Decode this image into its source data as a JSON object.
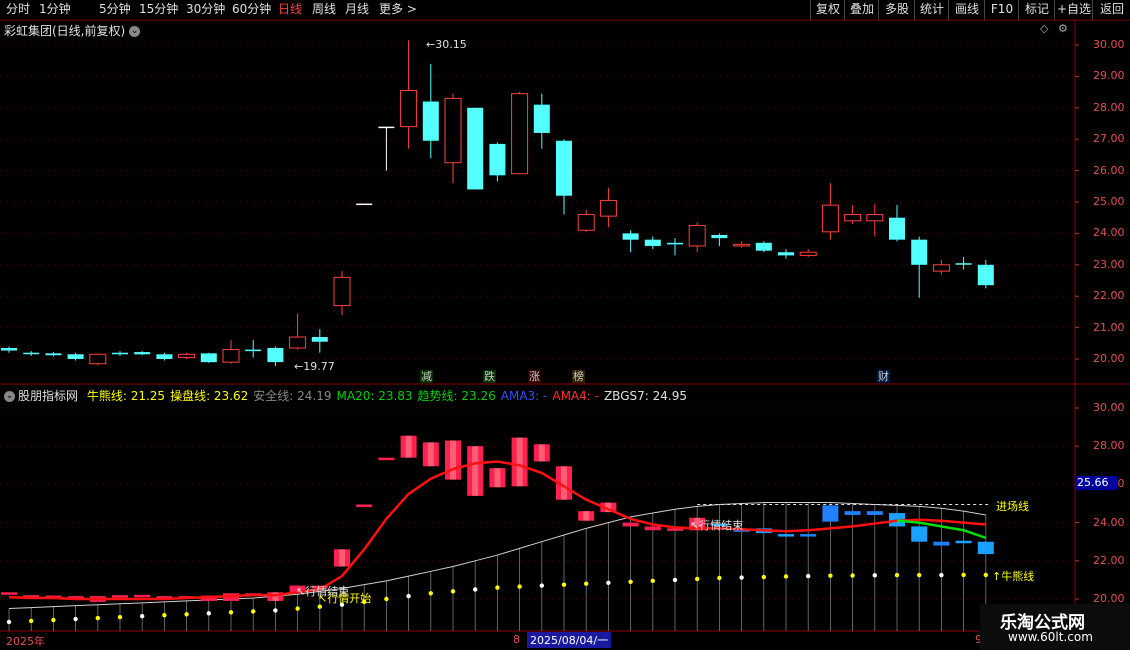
{
  "toolbar": {
    "periods": [
      "分时",
      "1分钟",
      "5分钟",
      "15分钟",
      "30分钟",
      "60分钟",
      "日线",
      "周线",
      "月线",
      "更多"
    ],
    "active_period": "日线",
    "more_arrow": ">",
    "right_buttons": [
      "复权",
      "叠加",
      "多股",
      "统计",
      "画线",
      "F10",
      "标记",
      "+自选",
      "返回"
    ]
  },
  "main_chart": {
    "title": "彩虹集团(日线,前复权)",
    "title_color": "#e0e0e0",
    "high_label": "30.15",
    "low_label": "19.77",
    "axis_labels": [
      "30.00",
      "29.00",
      "28.00",
      "27.00",
      "26.00",
      "25.00",
      "24.00",
      "23.00",
      "22.00",
      "21.00",
      "20.00"
    ],
    "event_marks": [
      {
        "text": "减",
        "color": "#00a000"
      },
      {
        "text": "跌",
        "color": "#00a000"
      },
      {
        "text": "涨",
        "color": "#c00000"
      },
      {
        "text": "榜",
        "color": "#8a5000"
      },
      {
        "text": "财",
        "color": "#2050c0"
      }
    ],
    "candles": [
      {
        "o": 20.27,
        "c": 20.35,
        "h": 20.4,
        "l": 20.2,
        "type": "down"
      },
      {
        "o": 20.2,
        "c": 20.16,
        "h": 20.25,
        "l": 20.1,
        "type": "down"
      },
      {
        "o": 20.18,
        "c": 20.12,
        "h": 20.22,
        "l": 20.08,
        "type": "down"
      },
      {
        "o": 20.15,
        "c": 20.0,
        "h": 20.2,
        "l": 19.95,
        "type": "down"
      },
      {
        "o": 19.85,
        "c": 20.15,
        "h": 20.18,
        "l": 19.8,
        "type": "up"
      },
      {
        "o": 20.2,
        "c": 20.15,
        "h": 20.25,
        "l": 20.1,
        "type": "down"
      },
      {
        "o": 20.22,
        "c": 20.15,
        "h": 20.25,
        "l": 20.12,
        "type": "down"
      },
      {
        "o": 20.15,
        "c": 20.0,
        "h": 20.2,
        "l": 19.95,
        "type": "down"
      },
      {
        "o": 20.05,
        "c": 20.15,
        "h": 20.2,
        "l": 20.0,
        "type": "up"
      },
      {
        "o": 20.18,
        "c": 19.9,
        "h": 20.2,
        "l": 19.88,
        "type": "down"
      },
      {
        "o": 19.9,
        "c": 20.3,
        "h": 20.6,
        "l": 19.85,
        "type": "up"
      },
      {
        "o": 20.3,
        "c": 20.25,
        "h": 20.6,
        "l": 20.05,
        "type": "down"
      },
      {
        "o": 20.35,
        "c": 19.9,
        "h": 20.4,
        "l": 19.77,
        "type": "down"
      },
      {
        "o": 20.35,
        "c": 20.7,
        "h": 21.45,
        "l": 20.3,
        "type": "up"
      },
      {
        "o": 20.7,
        "c": 20.55,
        "h": 20.95,
        "l": 20.2,
        "type": "down"
      },
      {
        "o": 21.7,
        "c": 22.6,
        "h": 22.8,
        "l": 21.4,
        "type": "up"
      },
      {
        "o": 24.95,
        "c": 24.95,
        "h": 24.95,
        "l": 24.95,
        "type": "flat"
      },
      {
        "o": 27.4,
        "c": 27.4,
        "h": 27.4,
        "l": 26.0,
        "type": "flat"
      },
      {
        "o": 27.4,
        "c": 28.55,
        "h": 30.15,
        "l": 26.7,
        "type": "up"
      },
      {
        "o": 28.2,
        "c": 26.95,
        "h": 29.4,
        "l": 26.4,
        "type": "down"
      },
      {
        "o": 26.25,
        "c": 28.3,
        "h": 28.45,
        "l": 25.6,
        "type": "up"
      },
      {
        "o": 28.0,
        "c": 25.4,
        "h": 28.0,
        "l": 25.4,
        "type": "down"
      },
      {
        "o": 26.85,
        "c": 25.85,
        "h": 26.9,
        "l": 25.65,
        "type": "down"
      },
      {
        "o": 25.9,
        "c": 28.45,
        "h": 28.5,
        "l": 25.9,
        "type": "up"
      },
      {
        "o": 28.1,
        "c": 27.2,
        "h": 28.45,
        "l": 26.7,
        "type": "down"
      },
      {
        "o": 26.95,
        "c": 25.2,
        "h": 27.0,
        "l": 24.6,
        "type": "down"
      },
      {
        "o": 24.1,
        "c": 24.6,
        "h": 24.75,
        "l": 24.05,
        "type": "up"
      },
      {
        "o": 24.55,
        "c": 25.05,
        "h": 25.45,
        "l": 24.2,
        "type": "up"
      },
      {
        "o": 24.0,
        "c": 23.8,
        "h": 24.1,
        "l": 23.4,
        "type": "down"
      },
      {
        "o": 23.8,
        "c": 23.6,
        "h": 23.9,
        "l": 23.5,
        "type": "down"
      },
      {
        "o": 23.7,
        "c": 23.65,
        "h": 23.85,
        "l": 23.3,
        "type": "down"
      },
      {
        "o": 23.6,
        "c": 24.25,
        "h": 24.35,
        "l": 23.4,
        "type": "up"
      },
      {
        "o": 23.95,
        "c": 23.85,
        "h": 24.0,
        "l": 23.6,
        "type": "down"
      },
      {
        "o": 23.6,
        "c": 23.65,
        "h": 23.75,
        "l": 23.55,
        "type": "up"
      },
      {
        "o": 23.7,
        "c": 23.45,
        "h": 23.75,
        "l": 23.4,
        "type": "down"
      },
      {
        "o": 23.4,
        "c": 23.3,
        "h": 23.5,
        "l": 23.2,
        "type": "down"
      },
      {
        "o": 23.3,
        "c": 23.4,
        "h": 23.5,
        "l": 23.25,
        "type": "up"
      },
      {
        "o": 24.05,
        "c": 24.9,
        "h": 25.6,
        "l": 23.8,
        "type": "up"
      },
      {
        "o": 24.4,
        "c": 24.6,
        "h": 24.9,
        "l": 24.3,
        "type": "up"
      },
      {
        "o": 24.4,
        "c": 24.6,
        "h": 24.95,
        "l": 23.9,
        "type": "up"
      },
      {
        "o": 24.5,
        "c": 23.8,
        "h": 24.9,
        "l": 23.75,
        "type": "down"
      },
      {
        "o": 23.8,
        "c": 23.0,
        "h": 23.9,
        "l": 21.95,
        "type": "down"
      },
      {
        "o": 22.8,
        "c": 23.0,
        "h": 23.15,
        "l": 22.7,
        "type": "up"
      },
      {
        "o": 23.05,
        "c": 23.05,
        "h": 23.25,
        "l": 22.85,
        "type": "down"
      },
      {
        "o": 23.0,
        "c": 22.35,
        "h": 23.15,
        "l": 22.25,
        "type": "down"
      }
    ]
  },
  "indicator": {
    "name": "股朋指标网",
    "items": [
      {
        "text": "牛熊线: 21.25",
        "color": "#ffff00"
      },
      {
        "text": "操盘线: 23.62",
        "color": "#ffff00"
      },
      {
        "text": "安全线: 24.19",
        "color": "#888888"
      },
      {
        "text": "MA20: 23.83",
        "color": "#00d000"
      },
      {
        "text": "趋势线: 23.26",
        "color": "#00d000"
      },
      {
        "text": "AMA3: -",
        "color": "#3050ff"
      },
      {
        "text": "AMA4: -",
        "color": "#ff3030"
      },
      {
        "text": "ZBGS7: 24.95",
        "color": "#e0e0e0"
      }
    ],
    "axis_labels": [
      "30.00",
      "28.00",
      "26.00",
      "24.00",
      "22.00",
      "20.00"
    ],
    "current_value": "25.66",
    "entry_line_label": "进场线",
    "bull_bear_label": "牛熊线",
    "annotation_start": "行情开始",
    "annotation_end": "行情结束",
    "annotation_mid": "行情结束",
    "entry_line_value": 24.95,
    "red_line": [
      20.1,
      20.05,
      20.05,
      20.0,
      20.0,
      20.0,
      20.0,
      20.0,
      20.05,
      20.1,
      20.15,
      20.2,
      20.2,
      20.35,
      20.5,
      21.2,
      22.6,
      24.2,
      25.5,
      26.3,
      26.8,
      27.1,
      27.2,
      27.0,
      26.6,
      25.9,
      25.2,
      24.7,
      24.2,
      23.9,
      23.75,
      23.7,
      23.7,
      23.65,
      23.6,
      23.55,
      23.6,
      23.7,
      23.8,
      23.95,
      24.1,
      24.15,
      24.1,
      24.0,
      23.9
    ],
    "white_line": [
      19.5,
      19.55,
      19.6,
      19.65,
      19.7,
      19.75,
      19.8,
      19.85,
      19.9,
      19.95,
      20.0,
      20.05,
      20.15,
      20.25,
      20.4,
      20.55,
      20.75,
      20.95,
      21.2,
      21.45,
      21.7,
      22.0,
      22.3,
      22.65,
      23.0,
      23.35,
      23.7,
      24.0,
      24.3,
      24.5,
      24.7,
      24.85,
      24.95,
      25.0,
      25.05,
      25.05,
      25.05,
      25.05,
      25.0,
      24.95,
      24.9,
      24.85,
      24.75,
      24.6,
      24.4
    ],
    "green_line_start": 40,
    "green_line": [
      24.1,
      24.0,
      23.8,
      23.6,
      23.2
    ],
    "dots": [
      18.8,
      18.85,
      18.9,
      18.95,
      19.0,
      19.05,
      19.1,
      19.15,
      19.2,
      19.25,
      19.3,
      19.35,
      19.4,
      19.5,
      19.6,
      19.7,
      19.85,
      20.0,
      20.15,
      20.3,
      20.4,
      20.5,
      20.6,
      20.65,
      20.7,
      20.75,
      20.8,
      20.85,
      20.9,
      20.95,
      21.0,
      21.05,
      21.1,
      21.12,
      21.15,
      21.18,
      21.2,
      21.22,
      21.23,
      21.24,
      21.25,
      21.25,
      21.25,
      21.26,
      21.26
    ]
  },
  "bottom": {
    "year_label": "2025年",
    "mid_label": "8",
    "date_label": "2025/08/04/一",
    "right_label": "9"
  },
  "logo": {
    "title": "乐淘公式网",
    "url": "www.60lt.com"
  }
}
